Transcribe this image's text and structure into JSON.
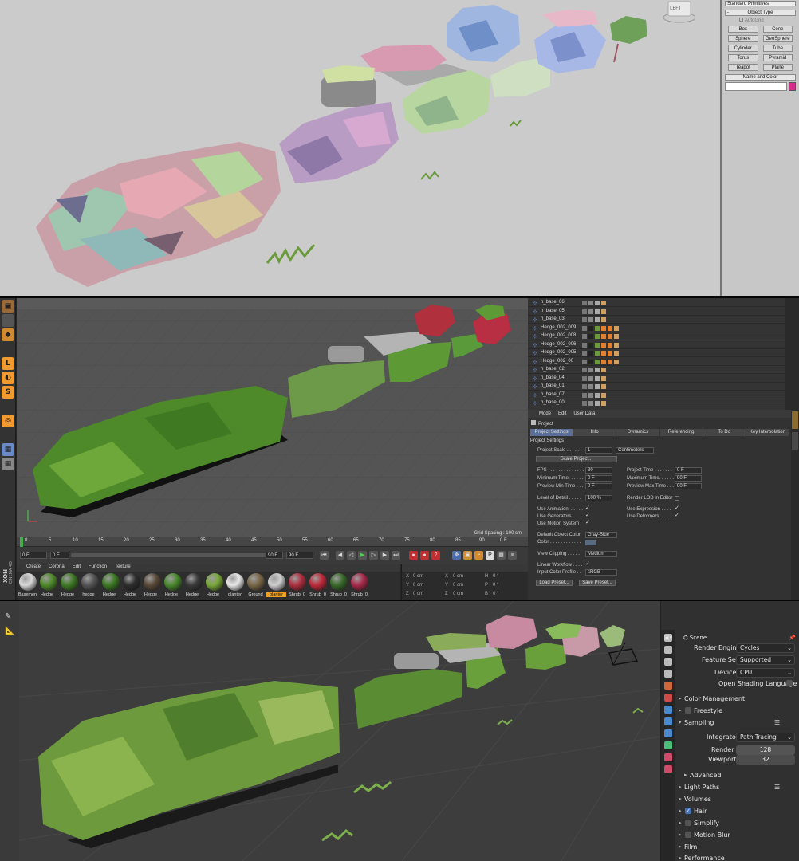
{
  "max": {
    "viewcube_label": "LEFT",
    "panel": {
      "dropdown_value": "Standard Primitives",
      "object_type_header": "Object Type",
      "autogrid_label": "AutoGrid",
      "buttons": [
        "Box",
        "Cone",
        "Sphere",
        "GeoSphere",
        "Cylinder",
        "Tube",
        "Torus",
        "Pyramid",
        "Teapot",
        "Plane"
      ],
      "name_color_header": "Name and Color",
      "name_value": "",
      "color": "#d62e8c"
    }
  },
  "c4d": {
    "viewport": {
      "grid_spacing": "Grid Spacing : 100 cm"
    },
    "timeline": {
      "ticks": [
        "0",
        "5",
        "10",
        "15",
        "20",
        "25",
        "30",
        "35",
        "40",
        "45",
        "50",
        "55",
        "60",
        "65",
        "70",
        "75",
        "80",
        "85",
        "90"
      ],
      "end_marker": "0 F",
      "current_frame": "0 F",
      "start_field": "0 F",
      "end_field": "90 F",
      "end_field2": "90 F"
    },
    "materials": {
      "menu": [
        "Create",
        "Corona",
        "Edit",
        "Function",
        "Texture"
      ],
      "items": [
        {
          "label": "Basemen",
          "color": "#d9d9d9"
        },
        {
          "label": "Hedge_",
          "color": "#4f8a2a"
        },
        {
          "label": "Hedge_",
          "color": "#3f7a24"
        },
        {
          "label": "hedge_",
          "color": "#555"
        },
        {
          "label": "Hedge_",
          "color": "#3c7a24"
        },
        {
          "label": "Hedge_",
          "color": "#2d2d2d"
        },
        {
          "label": "Hedge_",
          "color": "#5a4a38"
        },
        {
          "label": "Hedge_",
          "color": "#4a8a2e"
        },
        {
          "label": "Hedge_",
          "color": "#3a3a3a"
        },
        {
          "label": "Hedge_",
          "color": "#7aa83a"
        },
        {
          "label": "planter",
          "color": "#e8e8e8"
        },
        {
          "label": "Ground",
          "color": "#7a6848"
        },
        {
          "label": "planter",
          "color": "#cfcfcf"
        },
        {
          "label": "Shrub_0",
          "color": "#b03040"
        },
        {
          "label": "Shrub_0",
          "color": "#c02a3a"
        },
        {
          "label": "Shrub_0",
          "color": "#3a6a2a"
        },
        {
          "label": "Shrub_0",
          "color": "#a82a4a"
        }
      ],
      "selected_index": 12
    },
    "coords": {
      "rows": [
        {
          "a": "X",
          "av": "0 cm",
          "b": "X",
          "bv": "0 cm",
          "c": "H",
          "cv": "0 °"
        },
        {
          "a": "Y",
          "av": "0 cm",
          "b": "Y",
          "bv": "0 cm",
          "c": "P",
          "cv": "0 °"
        },
        {
          "a": "Z",
          "av": "0 cm",
          "b": "Z",
          "bv": "0 cm",
          "c": "B",
          "cv": "0 °"
        }
      ]
    },
    "objects": [
      "h_base_06",
      "h_base_05",
      "h_base_03",
      "Hedge_002_009",
      "Hedge_002_008",
      "Hedge_002_006",
      "Hedge_002_005",
      "Hedge_002_00",
      "h_base_02",
      "h_base_04",
      "h_base_01",
      "h_base_07",
      "h_base_00"
    ],
    "attributes": {
      "menu": [
        "Mode",
        "Edit",
        "User Data"
      ],
      "title": "Project",
      "tabs": [
        "Project Settings",
        "Info",
        "Dynamics",
        "Referencing",
        "To Do",
        "Key Interpolation"
      ],
      "section": "Project Settings",
      "project_scale_label": "Project Scale . . . . . .",
      "project_scale_value": "1",
      "project_scale_unit": "Centimeters",
      "scale_project_button": "Scale Project...",
      "fps_label": "FPS . . . . . . . . . . . . . .",
      "fps_value": "30",
      "project_time_label": "Project Time . . . . . . .",
      "project_time_value": "0 F",
      "min_time_label": "Minimum Time. . . . . .",
      "min_time_value": "0 F",
      "max_time_label": "Maximum Time. . . . . .",
      "max_time_value": "90 F",
      "prev_min_label": "Preview Min Time . . .",
      "prev_min_value": "0 F",
      "prev_max_label": "Preview Max Time . . .",
      "prev_max_value": "90 F",
      "lod_label": "Level of Detail . . . . .",
      "lod_value": "100 %",
      "render_lod_label": "Render LOD in Editor",
      "use_animation_label": "Use Animation. . . . . .",
      "use_expression_label": "Use Expression . . . .",
      "use_generators_label": "Use Generators . . . .",
      "use_deformers_label": "Use Deformers. . . . . .",
      "use_motion_label": "Use Motion System",
      "default_color_label": "Default Object Color",
      "default_color_value": "Gray-Blue",
      "color_label": "Color . . . . . . . . . . . .",
      "view_clipping_label": "View Clipping . . . . .",
      "view_clipping_value": "Medium",
      "linear_workflow_label": "Linear Workflow . . . .",
      "input_color_label": "Input Color Profile . .",
      "input_color_value": "sRGB",
      "load_preset_button": "Load Preset...",
      "save_preset_button": "Save Preset..."
    },
    "side_vertical_label": "XON",
    "side_vertical_label2": "CINEMA 4D"
  },
  "blender": {
    "props": {
      "scene_label": "Scene",
      "render_engine_label": "Render Engine",
      "render_engine_value": "Cycles",
      "feature_set_label": "Feature Set",
      "feature_set_value": "Supported",
      "device_label": "Device",
      "device_value": "CPU",
      "osl_label": "Open Shading Language",
      "color_management": "Color Management",
      "freestyle": "Freestyle",
      "sampling": "Sampling",
      "integrator_label": "Integrator",
      "integrator_value": "Path Tracing",
      "render_label": "Render",
      "render_value": "128",
      "viewport_label": "Viewport",
      "viewport_value": "32",
      "advanced": "Advanced",
      "light_paths": "Light Paths",
      "volumes": "Volumes",
      "hair": "Hair",
      "simplify": "Simplify",
      "motion_blur": "Motion Blur",
      "film": "Film",
      "performance": "Performance"
    }
  }
}
